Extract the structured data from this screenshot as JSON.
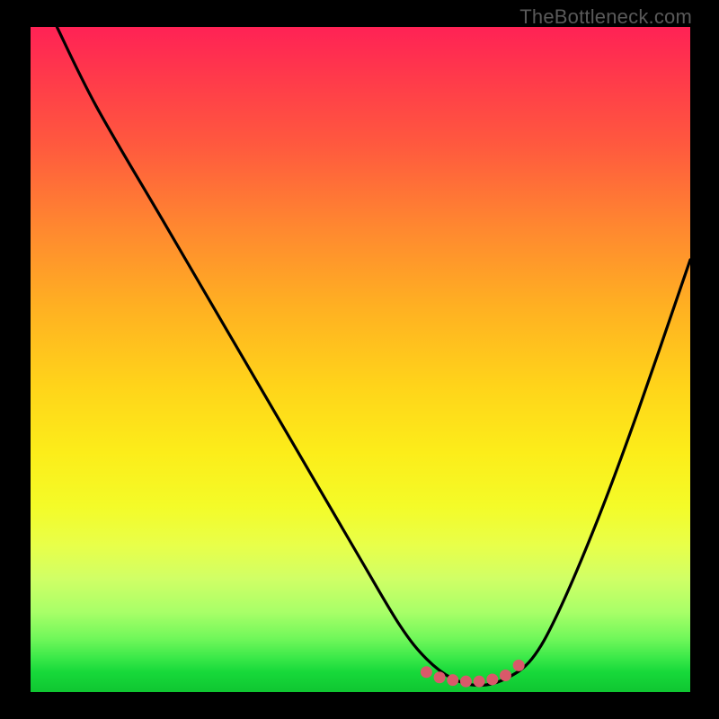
{
  "attribution": "TheBottleneck.com",
  "colors": {
    "frame_bg": "#000000",
    "curve_stroke": "#000000",
    "marker_fill": "#d9596a",
    "gradient_top": "#ff2255",
    "gradient_bottom": "#0fc631"
  },
  "chart_data": {
    "type": "line",
    "title": "",
    "xlabel": "",
    "ylabel": "",
    "xlim": [
      0,
      100
    ],
    "ylim": [
      0,
      100
    ],
    "series": [
      {
        "name": "bottleneck-curve",
        "x": [
          4,
          10,
          20,
          30,
          40,
          50,
          56,
          60,
          64,
          68,
          72,
          76,
          80,
          86,
          92,
          100
        ],
        "y": [
          100,
          88,
          71,
          54,
          37,
          20,
          10,
          5,
          2,
          1,
          2,
          5,
          12,
          26,
          42,
          65
        ]
      }
    ],
    "markers": {
      "name": "optimal-range",
      "x": [
        60,
        62,
        64,
        66,
        68,
        70,
        72,
        74
      ],
      "y": [
        3.0,
        2.2,
        1.8,
        1.6,
        1.6,
        1.9,
        2.5,
        4.0
      ]
    }
  }
}
